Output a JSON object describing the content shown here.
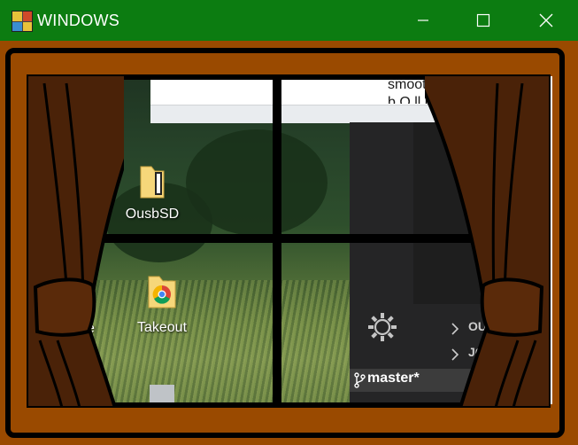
{
  "window": {
    "title": "WINDOWS",
    "minimize_label": "—",
    "maximize_label": "☐",
    "close_label": "✕",
    "colors": {
      "titlebar": "#0c7c11",
      "frame": "#9a4a00",
      "curtain": "#4a2208"
    }
  },
  "desktop": {
    "icons": [
      {
        "label": "OusbSD",
        "icon": "folder-icon"
      },
      {
        "label": "Takeout",
        "icon": "chrome-folder-icon"
      },
      {
        "label": "ke",
        "icon": "partial-label"
      }
    ]
  },
  "document": {
    "line1": "smoothly.  In additio",
    "line2": "b          O  ll   l t"
  },
  "editor": {
    "rows": [
      "OUTL",
      "JO"
    ],
    "branch": "master*",
    "icons": [
      "gear-icon",
      "chevron-right-icon",
      "branch-icon"
    ]
  }
}
